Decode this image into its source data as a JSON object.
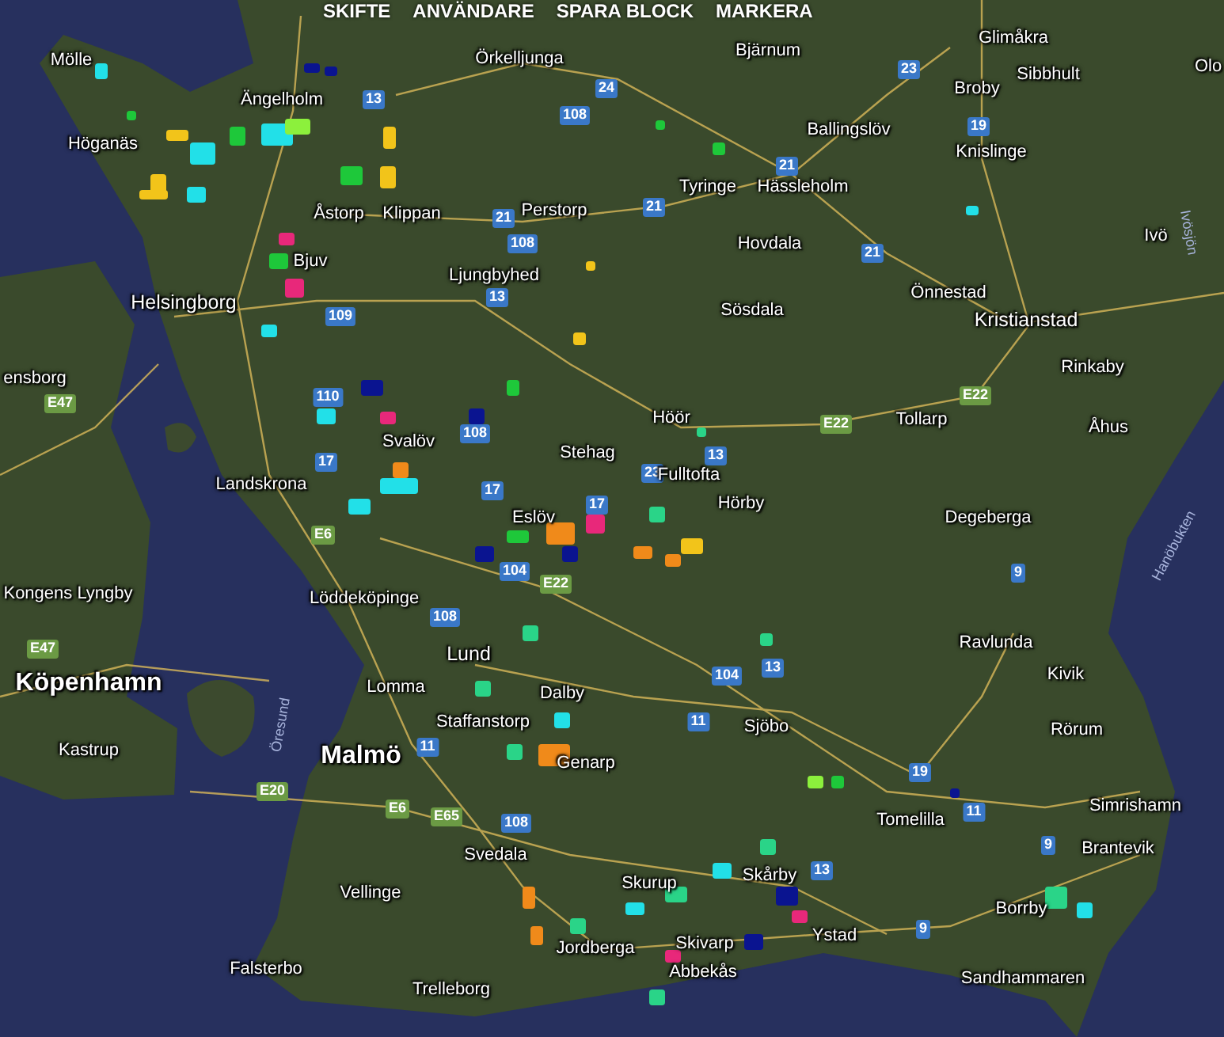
{
  "toolbar": {
    "items": [
      "SKIFTE",
      "ANVÄNDARE",
      "SPARA BLOCK",
      "MARKERA"
    ]
  },
  "map": {
    "places": [
      {
        "name": "Mölle",
        "kind": "town"
      },
      {
        "name": "Ängelholm",
        "kind": "town"
      },
      {
        "name": "Örkelljunga",
        "kind": "town"
      },
      {
        "name": "Bjärnum",
        "kind": "town"
      },
      {
        "name": "Glimåkra",
        "kind": "town"
      },
      {
        "name": "Olo",
        "kind": "town"
      },
      {
        "name": "Sibbhult",
        "kind": "town"
      },
      {
        "name": "Broby",
        "kind": "town"
      },
      {
        "name": "Ballingslöv",
        "kind": "town"
      },
      {
        "name": "Knislinge",
        "kind": "town"
      },
      {
        "name": "Höganäs",
        "kind": "town"
      },
      {
        "name": "Tyringe",
        "kind": "town"
      },
      {
        "name": "Hässleholm",
        "kind": "town"
      },
      {
        "name": "Åstorp",
        "kind": "town"
      },
      {
        "name": "Klippan",
        "kind": "town"
      },
      {
        "name": "Perstorp",
        "kind": "town"
      },
      {
        "name": "Hovdala",
        "kind": "town"
      },
      {
        "name": "Ivö",
        "kind": "town"
      },
      {
        "name": "Ivösjön",
        "kind": "lake"
      },
      {
        "name": "Bjuv",
        "kind": "town"
      },
      {
        "name": "Ljungbyhed",
        "kind": "town"
      },
      {
        "name": "Önnestad",
        "kind": "town"
      },
      {
        "name": "Helsingborg",
        "kind": "city"
      },
      {
        "name": "Sösdala",
        "kind": "town"
      },
      {
        "name": "Kristianstad",
        "kind": "city"
      },
      {
        "name": "ensborg",
        "kind": "town"
      },
      {
        "name": "Rinkaby",
        "kind": "town"
      },
      {
        "name": "Höör",
        "kind": "town"
      },
      {
        "name": "Tollarp",
        "kind": "town"
      },
      {
        "name": "Åhus",
        "kind": "town"
      },
      {
        "name": "Stehag",
        "kind": "town"
      },
      {
        "name": "Svalöv",
        "kind": "town"
      },
      {
        "name": "Landskrona",
        "kind": "town"
      },
      {
        "name": "Fulltofta",
        "kind": "town"
      },
      {
        "name": "Hörby",
        "kind": "town"
      },
      {
        "name": "Degeberga",
        "kind": "town"
      },
      {
        "name": "Hanöbukten",
        "kind": "bay"
      },
      {
        "name": "Eslöv",
        "kind": "town"
      },
      {
        "name": "Kongens Lyngby",
        "kind": "town"
      },
      {
        "name": "Löddeköpinge",
        "kind": "town"
      },
      {
        "name": "Lund",
        "kind": "city"
      },
      {
        "name": "Ravlunda",
        "kind": "town"
      },
      {
        "name": "Köpenhamn",
        "kind": "capital"
      },
      {
        "name": "Lomma",
        "kind": "town"
      },
      {
        "name": "Dalby",
        "kind": "town"
      },
      {
        "name": "Kivik",
        "kind": "town"
      },
      {
        "name": "Staffanstorp",
        "kind": "town"
      },
      {
        "name": "Öresund",
        "kind": "strait"
      },
      {
        "name": "Sjöbo",
        "kind": "town"
      },
      {
        "name": "Rörum",
        "kind": "town"
      },
      {
        "name": "Kastrup",
        "kind": "town"
      },
      {
        "name": "Malmö",
        "kind": "capital"
      },
      {
        "name": "Genarp",
        "kind": "town"
      },
      {
        "name": "Simrishamn",
        "kind": "town"
      },
      {
        "name": "Tomelilla",
        "kind": "town"
      },
      {
        "name": "Brantevik",
        "kind": "town"
      },
      {
        "name": "Svedala",
        "kind": "town"
      },
      {
        "name": "Skurup",
        "kind": "town"
      },
      {
        "name": "Skårby",
        "kind": "town"
      },
      {
        "name": "Vellinge",
        "kind": "town"
      },
      {
        "name": "Borrby",
        "kind": "town"
      },
      {
        "name": "Jordberga",
        "kind": "town"
      },
      {
        "name": "Skivarp",
        "kind": "town"
      },
      {
        "name": "Ystad",
        "kind": "town"
      },
      {
        "name": "Abbekås",
        "kind": "town"
      },
      {
        "name": "Sandhammaren",
        "kind": "town"
      },
      {
        "name": "Falsterbo",
        "kind": "town"
      },
      {
        "name": "Trelleborg",
        "kind": "town"
      }
    ],
    "shields": [
      {
        "label": "24",
        "kind": "national"
      },
      {
        "label": "13",
        "kind": "national"
      },
      {
        "label": "108",
        "kind": "national"
      },
      {
        "label": "23",
        "kind": "national"
      },
      {
        "label": "19",
        "kind": "national"
      },
      {
        "label": "21",
        "kind": "national"
      },
      {
        "label": "21",
        "kind": "national"
      },
      {
        "label": "108",
        "kind": "national"
      },
      {
        "label": "21",
        "kind": "national"
      },
      {
        "label": "21",
        "kind": "national"
      },
      {
        "label": "13",
        "kind": "national"
      },
      {
        "label": "109",
        "kind": "national"
      },
      {
        "label": "110",
        "kind": "national"
      },
      {
        "label": "108",
        "kind": "national"
      },
      {
        "label": "E47",
        "kind": "european"
      },
      {
        "label": "17",
        "kind": "national"
      },
      {
        "label": "17",
        "kind": "national"
      },
      {
        "label": "17",
        "kind": "national"
      },
      {
        "label": "23",
        "kind": "national"
      },
      {
        "label": "13",
        "kind": "national"
      },
      {
        "label": "E22",
        "kind": "european"
      },
      {
        "label": "E22",
        "kind": "european"
      },
      {
        "label": "E6",
        "kind": "european"
      },
      {
        "label": "104",
        "kind": "national"
      },
      {
        "label": "E22",
        "kind": "european"
      },
      {
        "label": "108",
        "kind": "national"
      },
      {
        "label": "E47",
        "kind": "european"
      },
      {
        "label": "104",
        "kind": "national"
      },
      {
        "label": "13",
        "kind": "national"
      },
      {
        "label": "11",
        "kind": "national"
      },
      {
        "label": "11",
        "kind": "national"
      },
      {
        "label": "E20",
        "kind": "european"
      },
      {
        "label": "E6",
        "kind": "european"
      },
      {
        "label": "E65",
        "kind": "european"
      },
      {
        "label": "108",
        "kind": "national"
      },
      {
        "label": "19",
        "kind": "national"
      },
      {
        "label": "11",
        "kind": "national"
      },
      {
        "label": "9",
        "kind": "national"
      },
      {
        "label": "13",
        "kind": "national"
      },
      {
        "label": "9",
        "kind": "national"
      },
      {
        "label": "9",
        "kind": "national"
      }
    ]
  }
}
